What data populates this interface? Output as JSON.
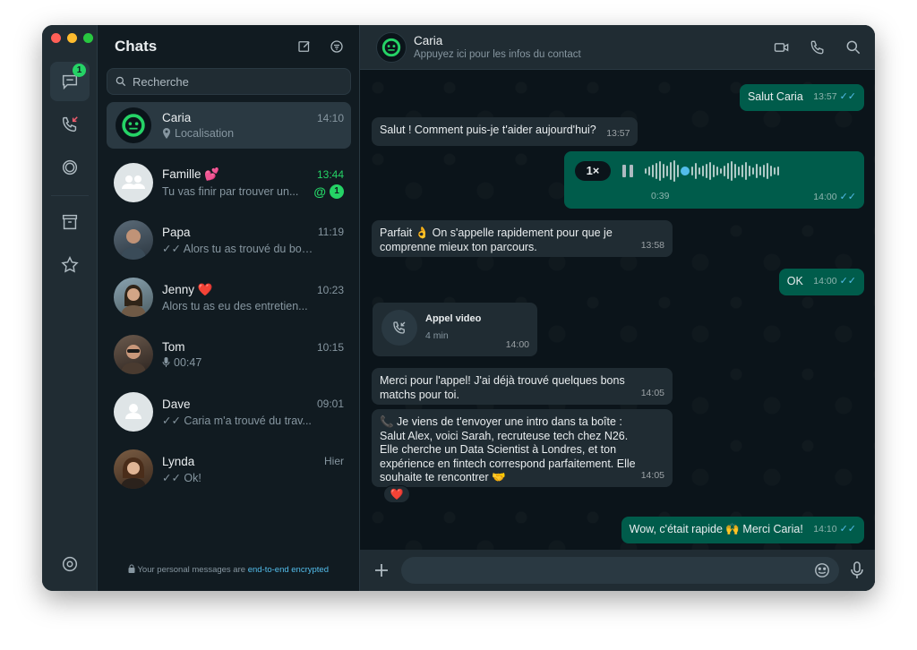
{
  "sidebar": {
    "chats_badge": "1"
  },
  "chat_list": {
    "title": "Chats",
    "search_placeholder": "Recherche",
    "items": [
      {
        "name": "Caria",
        "time": "14:10",
        "preview": "Localisation",
        "preview_icon": "pin-icon",
        "selected": true
      },
      {
        "name": "Famille 💕",
        "time": "13:44",
        "preview": "Tu vas finir par trouver un...",
        "unread": "1",
        "mention": "@"
      },
      {
        "name": "Papa",
        "time": "11:19",
        "preview": "✓✓ Alors tu as trouvé du boul..."
      },
      {
        "name": "Jenny ❤️",
        "time": "10:23",
        "preview": "Alors tu as eu des entretien..."
      },
      {
        "name": "Tom",
        "time": "10:15",
        "preview": "00:47",
        "preview_icon": "mic-icon"
      },
      {
        "name": "Dave",
        "time": "09:01",
        "preview": "✓✓ Caria m'a trouvé du trav..."
      },
      {
        "name": "Lynda",
        "time": "Hier",
        "preview": "✓✓ Ok!"
      }
    ],
    "encrypted_text": "Your personal messages are ",
    "encrypted_link": "end-to-end encrypted"
  },
  "conversation": {
    "name": "Caria",
    "subtitle": "Appuyez ici pour les infos du contact",
    "messages": [
      {
        "dir": "out",
        "text": "Salut Caria",
        "time": "13:57"
      },
      {
        "dir": "in",
        "text": "Salut ! Comment puis-je t'aider aujourd'hui?",
        "time": "13:57"
      },
      {
        "dir": "out",
        "type": "voice",
        "speed": "1×",
        "duration": "0:39",
        "time": "14:00"
      },
      {
        "dir": "in",
        "text": "Parfait 👌 On s'appelle rapidement pour que je comprenne mieux ton parcours.",
        "time": "13:58"
      },
      {
        "dir": "out",
        "text": "OK",
        "time": "14:00"
      },
      {
        "dir": "in",
        "type": "call",
        "title": "Appel video",
        "duration": "4 min",
        "time": "14:00"
      },
      {
        "dir": "in",
        "text": "Merci pour l'appel! J'ai déjà trouvé quelques bons matchs pour toi.",
        "time": "14:05"
      },
      {
        "dir": "in",
        "text": "📞 Je viens de t'envoyer une intro dans ta boîte : Salut Alex, voici Sarah, recruteuse tech chez N26. Elle cherche un Data Scientist à Londres, et ton expérience en fintech correspond parfaitement. Elle souhaite te rencontrer 🤝",
        "time": "14:05",
        "reaction": "❤️"
      },
      {
        "dir": "out",
        "text": "Wow, c'était rapide 🙌 Merci Caria!",
        "time": "14:10"
      }
    ],
    "ticks": "✓✓"
  },
  "composer": {
    "placeholder": ""
  },
  "colors": {
    "accent": "#25d366",
    "outgoing_bubble": "#005c4b",
    "incoming_bubble": "#202c33",
    "ticks": "#53bdeb"
  }
}
